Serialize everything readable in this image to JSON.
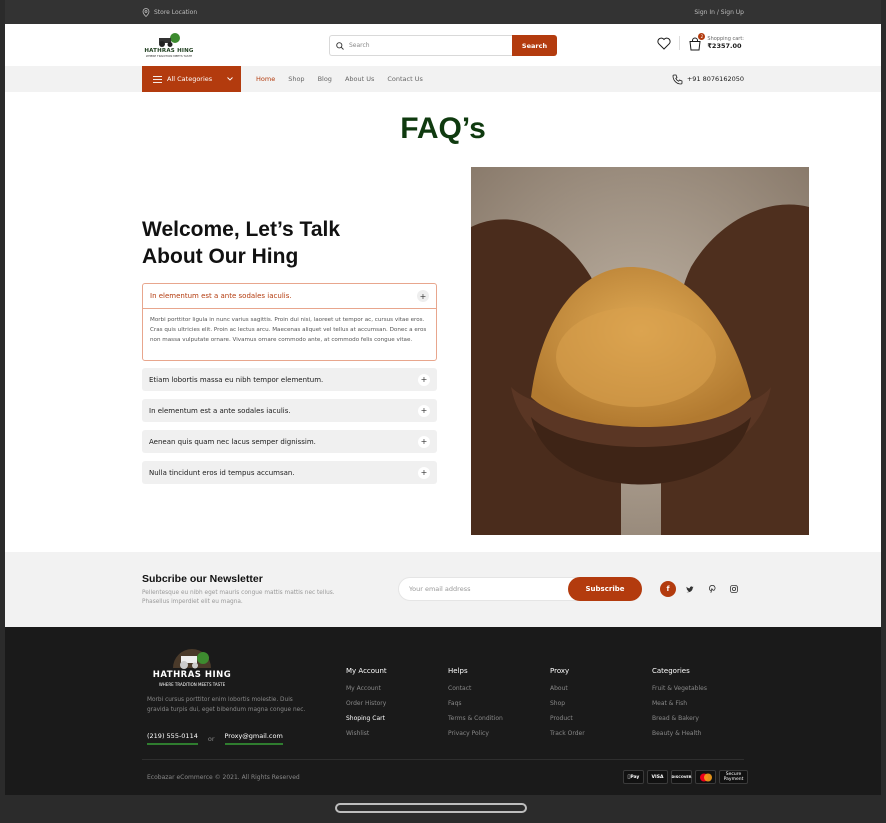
{
  "topbar": {
    "store_location": "Store Location",
    "sign_in": "Sign In",
    "divider": "/",
    "sign_up": "Sign Up"
  },
  "brand": {
    "name": "HATHRAS HING",
    "tagline": "WHERE TRADITION MEETS TASTE"
  },
  "search": {
    "placeholder": "Search",
    "button": "Search"
  },
  "cart": {
    "label": "Shopping cart:",
    "total": "₹2357.00",
    "count": "2"
  },
  "nav": {
    "all_categories": "All Categories",
    "items": [
      "Home",
      "Shop",
      "Blog",
      "About Us",
      "Contact Us"
    ],
    "phone": "+91 8076162050"
  },
  "page": {
    "title": "FAQ’s",
    "welcome": "Welcome, Let’s Talk About Our Hing"
  },
  "faq": {
    "open_question": "In elementum est a ante sodales iaculis.",
    "open_answer": "Morbi porttitor ligula in nunc varius sagittis. Proin dui nisi, laoreet ut tempor ac, cursus vitae eros. Cras quis ultricies elit. Proin ac lectus arcu. Maecenas aliquet vel tellus at accumsan. Donec a eros non massa vulputate ornare. Vivamus ornare commodo ante, at commodo felis congue vitae.",
    "items": [
      "Etiam lobortis massa eu nibh tempor elementum.",
      "In elementum est a ante sodales iaculis.",
      "Aenean quis quam nec lacus semper dignissim.",
      "Nulla tincidunt eros id tempus accumsan."
    ]
  },
  "newsletter": {
    "title": "Subcribe our Newsletter",
    "desc": "Pellentesque eu nibh eget mauris congue mattis mattis nec tellus. Phasellus imperdiet elit eu magna.",
    "placeholder": "Your email address",
    "button": "Subscribe"
  },
  "footer": {
    "desc": "Morbi cursus porttitor enim lobortis molestie. Duis gravida turpis dui, eget bibendum magna congue nec.",
    "phone": "(219) 555-0114",
    "or": "or",
    "email": "Proxy@gmail.com",
    "columns": [
      {
        "title": "My Account",
        "links": [
          "My Account",
          "Order History",
          "Shoping Cart",
          "Wishlist"
        ]
      },
      {
        "title": "Helps",
        "links": [
          "Contact",
          "Faqs",
          "Terms & Condition",
          "Privacy Policy"
        ]
      },
      {
        "title": "Proxy",
        "links": [
          "About",
          "Shop",
          "Product",
          "Track Order"
        ]
      },
      {
        "title": "Categories",
        "links": [
          "Fruit & Vegetables",
          "Meat & Fish",
          "Bread & Bakery",
          "Beauty & Health"
        ]
      }
    ],
    "copyright": "Ecobazar eCommerce © 2021. All Rights Reserved",
    "payments": [
      "Pay",
      "VISA",
      "DISCOVER",
      "",
      "Secure",
      "Payment"
    ]
  },
  "colors": {
    "accent": "#b33b0e",
    "title_green": "#0f3a0f",
    "footer_bg": "#1a1a1a"
  }
}
